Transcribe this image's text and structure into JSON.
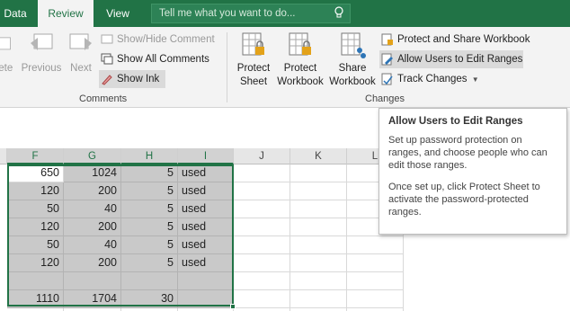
{
  "tabs": [
    {
      "label": "Data",
      "active": false
    },
    {
      "label": "Review",
      "active": true
    },
    {
      "label": "View",
      "active": false
    }
  ],
  "tellme": {
    "placeholder": "Tell me what you want to do..."
  },
  "ribbon": {
    "comments_group": {
      "label": "Comments",
      "delete_label": "lete",
      "previous_label": "Previous",
      "next_label": "Next",
      "show_hide_comment": "Show/Hide Comment",
      "show_all_comments": "Show All Comments",
      "show_ink": "Show Ink"
    },
    "changes_group": {
      "label": "Changes",
      "protect_sheet": [
        "Protect",
        "Sheet"
      ],
      "protect_workbook": [
        "Protect",
        "Workbook"
      ],
      "share_workbook": [
        "Share",
        "Workbook"
      ],
      "protect_and_share": "Protect and Share Workbook",
      "allow_users": "Allow Users to Edit Ranges",
      "track_changes": "Track Changes"
    }
  },
  "grid": {
    "columns": [
      "F",
      "G",
      "H",
      "I",
      "J",
      "K",
      "L"
    ],
    "rows": [
      [
        "650",
        "1024",
        "5",
        "used"
      ],
      [
        "120",
        "200",
        "5",
        "used"
      ],
      [
        "50",
        "40",
        "5",
        "used"
      ],
      [
        "120",
        "200",
        "5",
        "used"
      ],
      [
        "50",
        "40",
        "5",
        "used"
      ],
      [
        "120",
        "200",
        "5",
        "used"
      ],
      [
        "",
        "",
        "",
        ""
      ],
      [
        "1110",
        "1704",
        "30",
        ""
      ]
    ]
  },
  "tooltip": {
    "title": "Allow Users to Edit Ranges",
    "para1": "Set up password protection on ranges, and choose people who can edit those ranges.",
    "para2": "Once set up, click Protect Sheet to activate the password-protected ranges."
  },
  "colors": {
    "accent": "#217346",
    "selection": "#c9c9c9"
  }
}
